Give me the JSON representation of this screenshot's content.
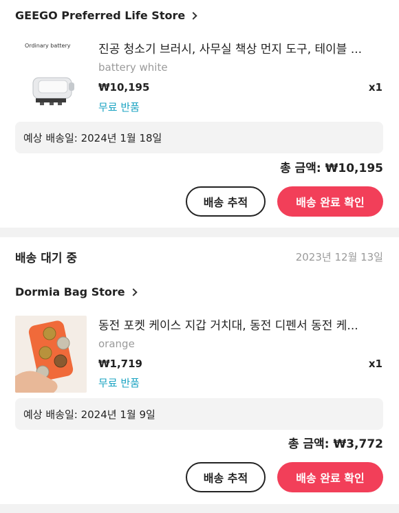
{
  "orders": [
    {
      "store": "GEEGO Preferred Life Store",
      "product": {
        "title": "진공 청소기 브러시, 사무실 책상 먼지 도구, 테이블 ...",
        "image_caption": "Ordinary battery",
        "variant": "battery white",
        "price": "₩10,195",
        "qty": "x1",
        "return_label": "무료 반품"
      },
      "delivery_estimate": "예상 배송일: 2024년 1월 18일",
      "total": "총 금액: ₩10,195",
      "track_label": "배송 추적",
      "confirm_label": "배송 완료 확인"
    },
    {
      "status": "배송 대기 중",
      "order_date": "2023년 12월 13일",
      "store": "Dormia Bag Store",
      "product": {
        "title": "동전 포켓 케이스 지갑 거치대, 동전 디펜서 동전 케...",
        "variant": "orange",
        "price": "₩1,719",
        "qty": "x1",
        "return_label": "무료 반품"
      },
      "delivery_estimate": "예상 배송일: 2024년 1월 9일",
      "total": "총 금액: ₩3,772",
      "track_label": "배송 추적",
      "confirm_label": "배송 완료 확인"
    }
  ],
  "colors": {
    "accent": "#f23f59",
    "return_link": "#1aa3c2",
    "muted": "#9a9a9a",
    "coin_case": "#f06a3a"
  },
  "icons": [
    "chevron-right-icon"
  ]
}
